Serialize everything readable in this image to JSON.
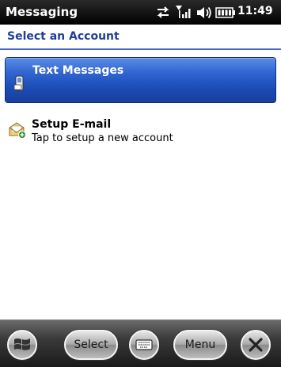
{
  "status_bar": {
    "title": "Messaging",
    "time": "11:49",
    "icons": [
      "data-transfer-icon",
      "signal-icon",
      "volume-icon",
      "battery-icon"
    ]
  },
  "header": {
    "title": "Select an Account"
  },
  "accounts": [
    {
      "label": "Text Messages",
      "subtitle": "",
      "icon": "text-message-icon",
      "selected": true
    },
    {
      "label": "Setup E-mail",
      "subtitle": "Tap to setup a new account",
      "icon": "setup-email-icon",
      "selected": false
    }
  ],
  "bottom_bar": {
    "start_icon": "windows-start-icon",
    "select_label": "Select",
    "keyboard_icon": "keyboard-icon",
    "menu_label": "Menu",
    "close_icon": "close-icon"
  },
  "colors": {
    "accent": "#1f3e9a",
    "selection": "#2f64d0",
    "status_bar": "#000000"
  }
}
